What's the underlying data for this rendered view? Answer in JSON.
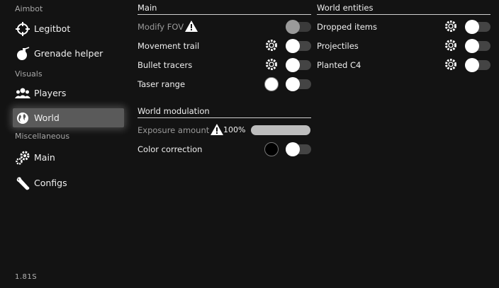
{
  "sidebar": {
    "sections": [
      {
        "label": "Aimbot"
      },
      {
        "label": "Visuals"
      },
      {
        "label": "Miscellaneous"
      }
    ],
    "items": [
      {
        "label": "Legitbot",
        "icon": "crosshair-icon"
      },
      {
        "label": "Grenade helper",
        "icon": "grenade-icon"
      },
      {
        "label": "Players",
        "icon": "players-icon"
      },
      {
        "label": "World",
        "icon": "globe-icon",
        "active": true
      },
      {
        "label": "Main",
        "icon": "gears-icon"
      },
      {
        "label": "Configs",
        "icon": "wrench-icon"
      }
    ],
    "version": "1.81S"
  },
  "main": {
    "title": "Main",
    "rows": [
      {
        "label": "Modify FOV",
        "disabled": true,
        "warning": true,
        "toggle": false
      },
      {
        "label": "Movement trail",
        "gear": true,
        "toggle": false
      },
      {
        "label": "Bullet tracers",
        "gear": true,
        "toggle": false
      },
      {
        "label": "Taser range",
        "color": "#ffffff",
        "toggle": false
      }
    ]
  },
  "world_modulation": {
    "title": "World modulation",
    "exposure": {
      "label": "Exposure amount",
      "value": "100%",
      "disabled": true,
      "warning": true,
      "fraction": 1.0
    },
    "color_correction": {
      "label": "Color correction",
      "color": "#000000",
      "toggle": false
    }
  },
  "world_entities": {
    "title": "World entities",
    "rows": [
      {
        "label": "Dropped items",
        "gear": true,
        "toggle": false
      },
      {
        "label": "Projectiles",
        "gear": true,
        "toggle": false
      },
      {
        "label": "Planted C4",
        "gear": true,
        "toggle": false
      }
    ]
  },
  "colors": {
    "background": "#131313",
    "active_item": "#5a5a5a",
    "knob": "#ffffff",
    "track": "#444444"
  }
}
